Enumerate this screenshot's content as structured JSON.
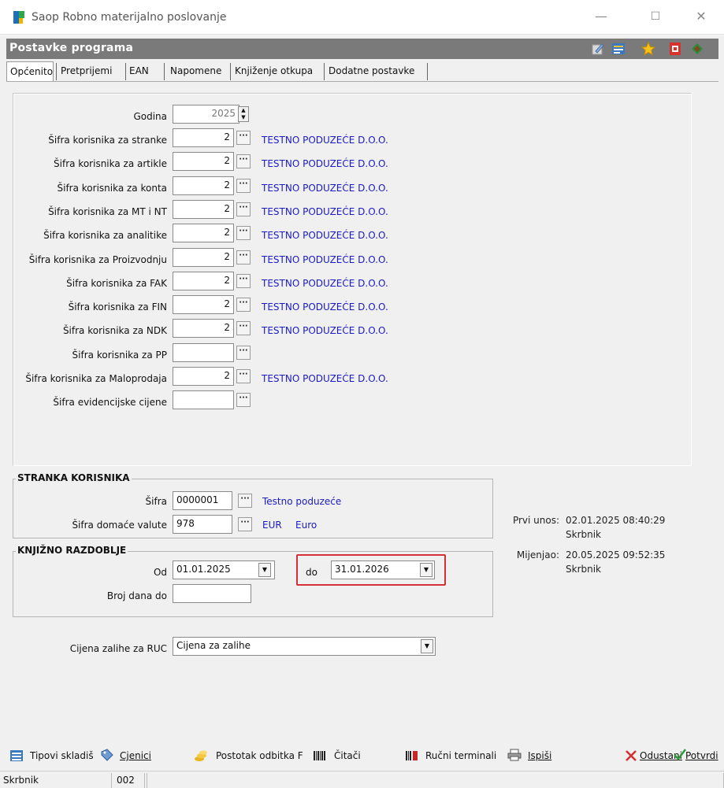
{
  "window": {
    "title": "Saop Robno materijalno poslovanje",
    "minimize": "—",
    "maximize": "☐",
    "close": "✕"
  },
  "header": {
    "title": "Postavke programa"
  },
  "tabs": [
    {
      "label": "Općenito",
      "active": true
    },
    {
      "label": "Pretprijemi"
    },
    {
      "label": "EAN"
    },
    {
      "label": "Napomene"
    },
    {
      "label": "Knjiženje otkupa"
    },
    {
      "label": "Dodatne postavke"
    }
  ],
  "general": {
    "godina_label": "Godina",
    "godina_value": "2025",
    "rows": [
      {
        "label": "Šifra korisnika za stranke",
        "value": "2",
        "company": "TESTNO PODUZEĆE D.O.O."
      },
      {
        "label": "Šifra korisnika za artikle",
        "value": "2",
        "company": "TESTNO PODUZEĆE D.O.O."
      },
      {
        "label": "Šifra korisnika za konta",
        "value": "2",
        "company": "TESTNO PODUZEĆE D.O.O."
      },
      {
        "label": "Šifra korisnika za MT i NT",
        "value": "2",
        "company": "TESTNO PODUZEĆE D.O.O."
      },
      {
        "label": "Šifra korisnika za analitike",
        "value": "2",
        "company": "TESTNO PODUZEĆE D.O.O."
      },
      {
        "label": "Šifra korisnika za Proizvodnju",
        "value": "2",
        "company": "TESTNO PODUZEĆE D.O.O."
      },
      {
        "label": "Šifra korisnika za FAK",
        "value": "2",
        "company": "TESTNO PODUZEĆE D.O.O."
      },
      {
        "label": "Šifra korisnika za FIN",
        "value": "2",
        "company": "TESTNO PODUZEĆE D.O.O."
      },
      {
        "label": "Šifra korisnika za NDK",
        "value": "2",
        "company": "TESTNO PODUZEĆE D.O.O."
      },
      {
        "label": "Šifra korisnika za PP",
        "value": "",
        "company": ""
      },
      {
        "label": "Šifra korisnika za Maloprodaja",
        "value": "2",
        "company": "TESTNO PODUZEĆE D.O.O."
      },
      {
        "label": "Šifra evidencijske cijene",
        "value": "",
        "company": ""
      }
    ],
    "ellipsis": "···"
  },
  "stranka": {
    "title": "STRANKA KORISNIKA",
    "sifra_label": "Šifra",
    "sifra_value": "0000001",
    "sifra_name": "Testno poduzeće",
    "valuta_label": "Šifra domaće valute",
    "valuta_value": "978",
    "valuta_code": "EUR",
    "valuta_name": "Euro"
  },
  "razdoblje": {
    "title": "KNJIŽNO RAZDOBLJE",
    "od_label": "Od",
    "od_value": "01.01.2025",
    "do_label": "do",
    "do_value": "31.01.2026",
    "broj_label": "Broj dana do",
    "broj_value": ""
  },
  "audit": {
    "prvi_label": "Prvi unos:",
    "prvi_value": "02.01.2025 08:40:29",
    "prvi_user": "Skrbnik",
    "mijenjao_label": "Mijenjao:",
    "mijenjao_value": "20.05.2025 09:52:35",
    "mijenjao_user": "Skrbnik"
  },
  "ruc": {
    "label": "Cijena zalihe za RUC",
    "value": "Cijena za zalihe"
  },
  "toolbar": {
    "tipovi": "Tipovi skladiš",
    "cjenici": "Cjenici",
    "postotak": "Postotak odbitka F",
    "citaci": "Čitači",
    "rucni": "Ručni terminali",
    "ispisi": "Ispiši",
    "odustani": "Odustani",
    "potvrdi": "Potvrdi"
  },
  "status": {
    "user": "Skrbnik",
    "code": "002"
  },
  "colors": {
    "link": "#1b1bc4",
    "header": "#7a7a7a",
    "highlight": "#d4303a"
  }
}
